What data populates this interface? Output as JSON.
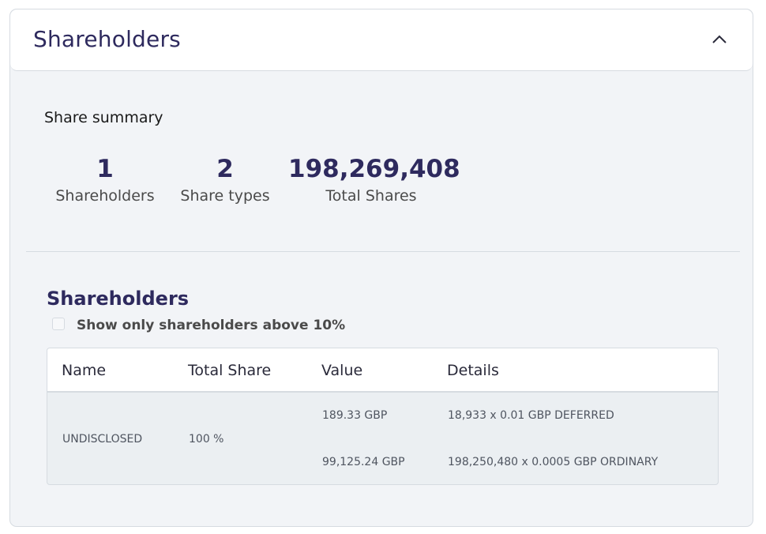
{
  "header": {
    "title": "Shareholders",
    "chevron_icon": "chevron-up-icon"
  },
  "summary": {
    "title": "Share summary",
    "stats": [
      {
        "value": "1",
        "label": "Shareholders"
      },
      {
        "value": "2",
        "label": "Share types"
      },
      {
        "value": "198,269,408",
        "label": "Total Shares"
      }
    ]
  },
  "shareholders": {
    "title": "Shareholders",
    "filter_label": "Show only shareholders above 10%",
    "filter_checked": false,
    "columns": [
      "Name",
      "Total Share",
      "Value",
      "Details"
    ],
    "rows": [
      {
        "name": "UNDISCLOSED",
        "total_share": "100 %",
        "values": [
          "189.33 GBP",
          "99,125.24 GBP"
        ],
        "details": [
          "18,933 x 0.01 GBP DEFERRED",
          "198,250,480 x 0.0005 GBP ORDINARY"
        ]
      }
    ]
  },
  "colors": {
    "primary": "#2e2a5e",
    "panel": "#f2f4f7",
    "row": "#ebeff2",
    "border": "#d6dbe1"
  }
}
